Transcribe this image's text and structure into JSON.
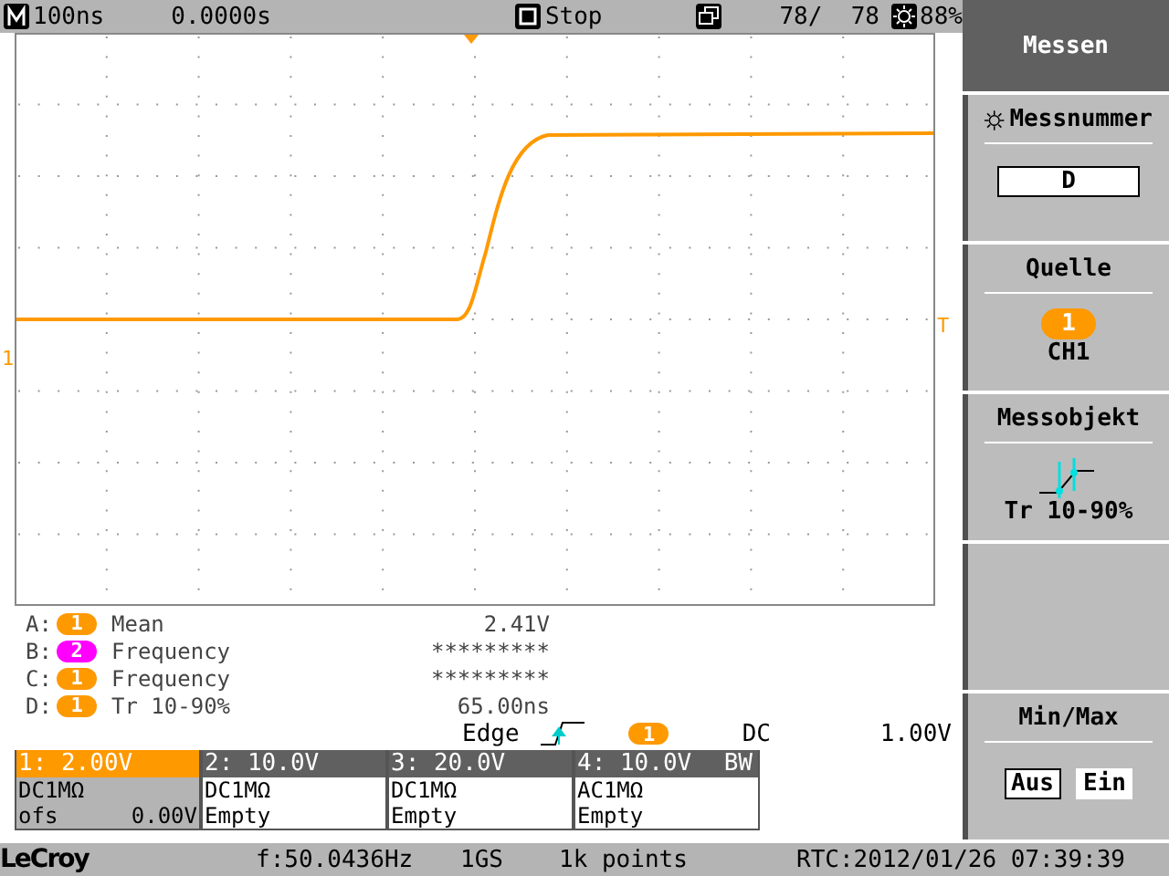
{
  "status_bar": {
    "timebase": "100ns",
    "delay": "0.0000s",
    "run_state": "Stop",
    "acquisitions": "78/  78",
    "intensity": "88%"
  },
  "plot": {
    "trace_marker": "1",
    "trigger_marker": "T"
  },
  "measurements": [
    {
      "letter": "A:",
      "source": "1",
      "color": "#ff9900",
      "name": "Mean",
      "value": "2.41V"
    },
    {
      "letter": "B:",
      "source": "2",
      "color": "#ff00ff",
      "name": "Frequency",
      "value": "*********"
    },
    {
      "letter": "C:",
      "source": "1",
      "color": "#ff9900",
      "name": "Frequency",
      "value": "*********"
    },
    {
      "letter": "D:",
      "source": "1",
      "color": "#ff9900",
      "name": "Tr 10-90%",
      "value": "65.00ns"
    }
  ],
  "trigger": {
    "label": "Edge",
    "source": "1",
    "coupling": "DC",
    "level": "1.00V"
  },
  "channels": [
    {
      "label": "1: 2.00V",
      "selected": true,
      "coupling": "DC1MΩ",
      "offset_label": "ofs",
      "offset": "0.00V"
    },
    {
      "label": "2: 10.0V",
      "selected": false,
      "coupling": "DC1MΩ",
      "status": "Empty"
    },
    {
      "label": "3: 20.0V",
      "selected": false,
      "coupling": "DC1MΩ",
      "status": "Empty"
    },
    {
      "label": "4: 10.0V",
      "bw": "BW",
      "selected": false,
      "coupling": "AC1MΩ",
      "status": "Empty"
    }
  ],
  "menu": {
    "title": "Messen",
    "items": [
      {
        "kind": "value",
        "label": "Messnummer",
        "value": "D"
      },
      {
        "kind": "source",
        "label": "Quelle",
        "badge": "1",
        "value": "CH1"
      },
      {
        "kind": "object",
        "label": "Messobjekt",
        "value": "Tr 10-90%"
      },
      {
        "kind": "empty"
      },
      {
        "kind": "toggle",
        "label": "Min/Max",
        "options": [
          {
            "label": "Aus",
            "selected": true
          },
          {
            "label": "Ein",
            "selected": false
          }
        ]
      }
    ]
  },
  "footer": {
    "brand": "LeCroy",
    "frequency": "f:50.0436Hz",
    "sample_rate": "1GS",
    "points": "1k points",
    "rtc": "RTC:2012/01/26 07:39:39"
  }
}
